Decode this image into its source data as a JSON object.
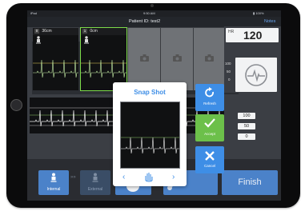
{
  "status_bar": {
    "carrier": "iPad",
    "time": "9:50 AM",
    "battery": "▮ 100%"
  },
  "title_bar": {
    "patient": "Patient ID: test2",
    "notes": "Notes"
  },
  "panels": [
    {
      "num": "0",
      "dist": "36cm"
    },
    {
      "num": "1",
      "dist": "0cm"
    }
  ],
  "vitals": {
    "hr_label": "HR",
    "hr_value": "120",
    "side_labels": [
      "100",
      "50",
      "0"
    ]
  },
  "number_boxes": [
    "100",
    "50",
    "0"
  ],
  "modal": {
    "title": "Snap Shot",
    "prev": "‹",
    "next": "›"
  },
  "controls": {
    "refresh": "Refresh",
    "accept": "Accept",
    "cancel": "Cancel"
  },
  "bottom": {
    "internal": "Internal",
    "external": "External",
    "finish": "Finish"
  },
  "colors": {
    "accent": "#3e8ee6",
    "accept": "#6cc04a",
    "refresh": "#3e8ee6",
    "cancel": "#3e8ee6",
    "button": "#4b82c9",
    "trace": "#b9f0a5"
  }
}
